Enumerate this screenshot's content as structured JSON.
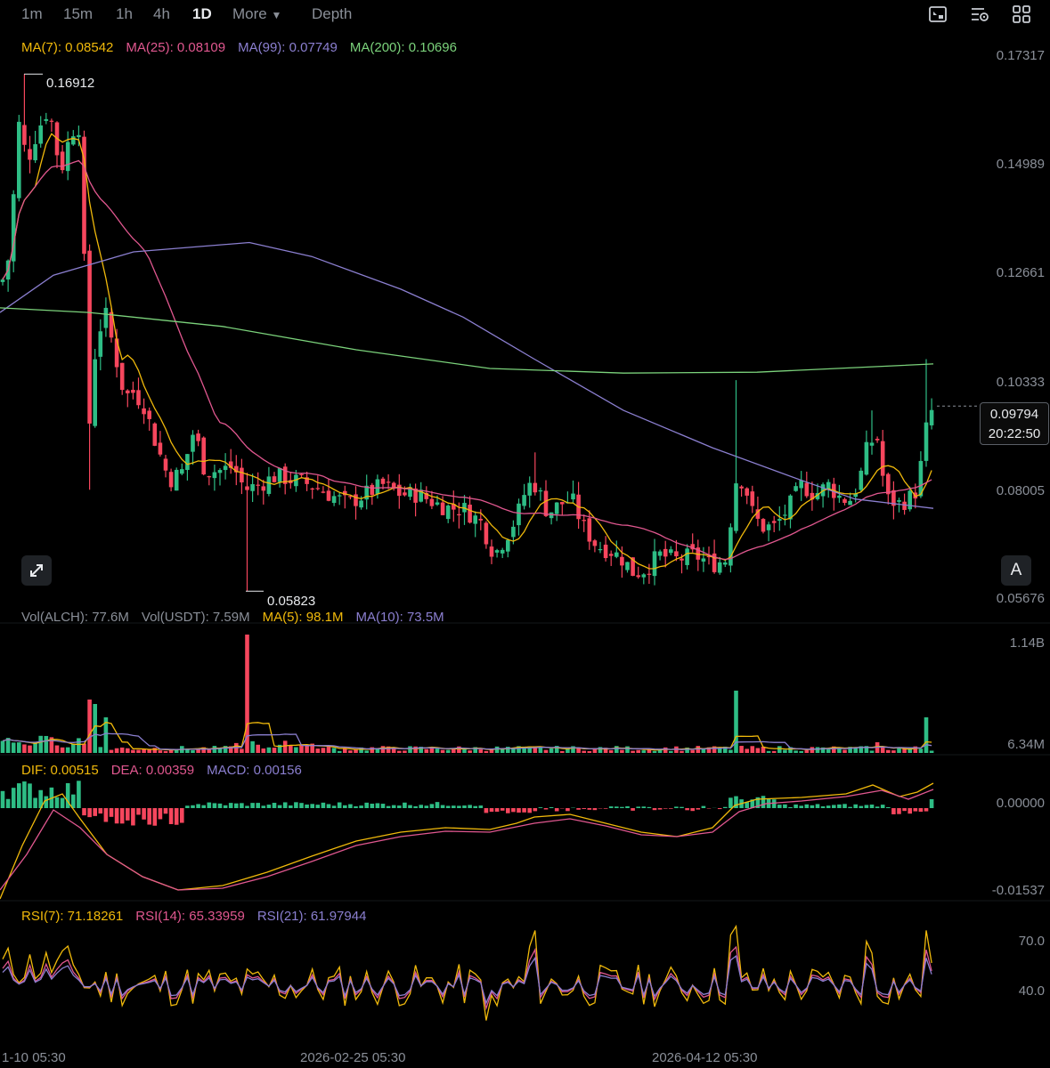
{
  "toolbar": {
    "timeframes": [
      "1m",
      "15m",
      "1h",
      "4h",
      "1D"
    ],
    "active_index": 4,
    "more_label": "More",
    "depth_label": "Depth"
  },
  "icons": {
    "settings_1": "chart-settings-icon",
    "settings_2": "indicator-settings-icon",
    "layout": "grid-layout-icon",
    "expand": "expand-arrows-icon"
  },
  "legends": {
    "ma": [
      {
        "label": "MA(7): 0.08542",
        "color": "#f0b90b"
      },
      {
        "label": "MA(25): 0.08109",
        "color": "#e0578f"
      },
      {
        "label": "MA(99): 0.07749",
        "color": "#8b7fd0"
      },
      {
        "label": "MA(200): 0.10696",
        "color": "#7bd27b"
      }
    ],
    "vol": [
      {
        "label": "Vol(ALCH): 77.6M",
        "color": "#8a8f98"
      },
      {
        "label": "Vol(USDT): 7.59M",
        "color": "#8a8f98"
      },
      {
        "label": "MA(5): 98.1M",
        "color": "#f0b90b"
      },
      {
        "label": "MA(10): 73.5M",
        "color": "#8b7fd0"
      }
    ],
    "macd": [
      {
        "label": "DIF: 0.00515",
        "color": "#f0b90b"
      },
      {
        "label": "DEA: 0.00359",
        "color": "#e0578f"
      },
      {
        "label": "MACD: 0.00156",
        "color": "#8b7fd0"
      }
    ],
    "rsi": [
      {
        "label": "RSI(7): 71.18261",
        "color": "#f0b90b"
      },
      {
        "label": "RSI(14): 65.33959",
        "color": "#e0578f"
      },
      {
        "label": "RSI(21): 61.97944",
        "color": "#8b7fd0"
      }
    ]
  },
  "price_tag": {
    "price": "0.09794",
    "countdown": "20:22:50"
  },
  "annotations": {
    "high": "0.16912",
    "low": "0.05823"
  },
  "auto_button_label": "A",
  "chart_data": {
    "type": "candlestick",
    "colors": {
      "up": "#2ebd85",
      "down": "#f6465d",
      "ma7": "#f0b90b",
      "ma25": "#e0578f",
      "ma99": "#8b7fd0",
      "ma200": "#7bd27b"
    },
    "x_axis": {
      "tick_labels": [
        "1-10 05:30",
        "2026-02-25 05:30",
        "2026-04-12 05:30"
      ]
    },
    "price_axis": {
      "ticks": [
        "0.17317",
        "0.14989",
        "0.12661",
        "0.10333",
        "0.08005",
        "0.05676"
      ],
      "range": [
        0.055,
        0.178
      ]
    },
    "volume_axis": {
      "ticks": [
        "1.14B",
        "6.34M"
      ]
    },
    "macd_axis": {
      "ticks": [
        "0.00000",
        "-0.01537"
      ]
    },
    "rsi_axis": {
      "ticks": [
        "70.0",
        "40.0"
      ]
    },
    "ma200_last": 0.10696,
    "last_price": 0.09794
  }
}
